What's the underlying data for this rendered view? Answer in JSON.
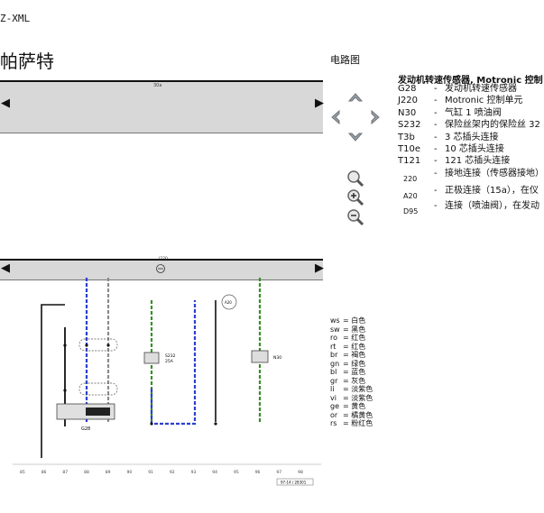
{
  "header": {
    "code": "Z-XML",
    "title": "帕萨特",
    "subtitle": "电路图"
  },
  "legend": {
    "title": "发动机转速传感器, Motronic 控制",
    "items": [
      {
        "code": "G28",
        "desc": "发动机转速传感器"
      },
      {
        "code": "J220",
        "desc": "Motronic 控制单元"
      },
      {
        "code": "N30",
        "desc": "气缸 1 喷油阀"
      },
      {
        "code": "S232",
        "desc": "保险丝架内的保险丝 32"
      },
      {
        "code": "T3b",
        "desc": "3 芯插头连接"
      },
      {
        "code": "T10e",
        "desc": "10 芯插头连接"
      },
      {
        "code": "T121",
        "desc": "121 芯插头连接"
      },
      {
        "code": "220",
        "desc": "接地连接（传感器接地）"
      },
      {
        "code": "A20",
        "desc": "正极连接（15a），在仪"
      },
      {
        "code": "D95",
        "desc": "连接（喷油阀），在发动"
      }
    ]
  },
  "navigation": {
    "up": "up-arrow-icon",
    "left": "left-arrow-icon",
    "right": "right-arrow-icon",
    "down": "down-arrow-icon"
  },
  "zoom_tools": [
    "zoom-fit-icon",
    "zoom-in-icon",
    "zoom-out-icon"
  ],
  "diagram": {
    "top_bar_label": "30a",
    "bus_label": "J220",
    "bottom_refs": [
      "85",
      "86",
      "87",
      "88",
      "89",
      "90",
      "91",
      "92",
      "93",
      "94",
      "95",
      "96",
      "97",
      "98"
    ],
    "code_label": "97-14 / 28301",
    "component_labels": {
      "g28": "G28",
      "s232": "S232",
      "s232_rating": "25A",
      "n30": "N30",
      "a20": "A20"
    }
  },
  "wire_colors": [
    {
      "abbr": "ws",
      "name": "白色"
    },
    {
      "abbr": "sw",
      "name": "黑色"
    },
    {
      "abbr": "ro",
      "name": "红色"
    },
    {
      "abbr": "rt",
      "name": "红色"
    },
    {
      "abbr": "br",
      "name": "褐色"
    },
    {
      "abbr": "gn",
      "name": "绿色"
    },
    {
      "abbr": "bl",
      "name": "蓝色"
    },
    {
      "abbr": "gr",
      "name": "灰色"
    },
    {
      "abbr": "li",
      "name": "淡紫色"
    },
    {
      "abbr": "vi",
      "name": "淡紫色"
    },
    {
      "abbr": "ge",
      "name": "黄色"
    },
    {
      "abbr": "or",
      "name": "橘黄色"
    },
    {
      "abbr": "rs",
      "name": "粉红色"
    }
  ],
  "colors": {
    "panel": "#d8d8d8",
    "blue_wire": "#2b3fd1",
    "green_wire": "#3a8f2a",
    "gray_wire": "#8c8c8c",
    "black_wire": "#111111",
    "nav_arrow": "#8a8f95"
  }
}
